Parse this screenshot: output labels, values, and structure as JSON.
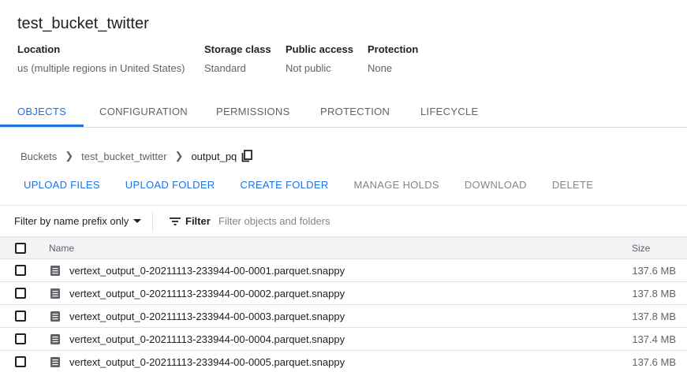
{
  "bucket": {
    "title": "test_bucket_twitter",
    "meta": [
      {
        "label": "Location",
        "value": "us (multiple regions in United States)"
      },
      {
        "label": "Storage class",
        "value": "Standard"
      },
      {
        "label": "Public access",
        "value": "Not public"
      },
      {
        "label": "Protection",
        "value": "None"
      }
    ]
  },
  "tabs": [
    {
      "label": "OBJECTS",
      "active": true
    },
    {
      "label": "CONFIGURATION",
      "active": false
    },
    {
      "label": "PERMISSIONS",
      "active": false
    },
    {
      "label": "PROTECTION",
      "active": false
    },
    {
      "label": "LIFECYCLE",
      "active": false
    }
  ],
  "breadcrumb": {
    "items": [
      "Buckets",
      "test_bucket_twitter",
      "output_pq"
    ],
    "copy_icon": "copy-icon"
  },
  "actions": [
    {
      "label": "UPLOAD FILES",
      "enabled": true
    },
    {
      "label": "UPLOAD FOLDER",
      "enabled": true
    },
    {
      "label": "CREATE FOLDER",
      "enabled": true
    },
    {
      "label": "MANAGE HOLDS",
      "enabled": false
    },
    {
      "label": "DOWNLOAD",
      "enabled": false
    },
    {
      "label": "DELETE",
      "enabled": false
    }
  ],
  "filter": {
    "mode_label": "Filter by name prefix only",
    "filter_label": "Filter",
    "placeholder": "Filter objects and folders",
    "value": ""
  },
  "table": {
    "columns": {
      "name": "Name",
      "size": "Size"
    },
    "rows": [
      {
        "name": "vertext_output_0-20211113-233944-00-0001.parquet.snappy",
        "size": "137.6 MB"
      },
      {
        "name": "vertext_output_0-20211113-233944-00-0002.parquet.snappy",
        "size": "137.8 MB"
      },
      {
        "name": "vertext_output_0-20211113-233944-00-0003.parquet.snappy",
        "size": "137.8 MB"
      },
      {
        "name": "vertext_output_0-20211113-233944-00-0004.parquet.snappy",
        "size": "137.4 MB"
      },
      {
        "name": "vertext_output_0-20211113-233944-00-0005.parquet.snappy",
        "size": "137.6 MB"
      }
    ]
  },
  "colors": {
    "accent": "#1a73e8",
    "text_primary": "#202124",
    "text_secondary": "#5f6368",
    "disabled": "#80868b",
    "header_bg": "#f1f3f4"
  }
}
